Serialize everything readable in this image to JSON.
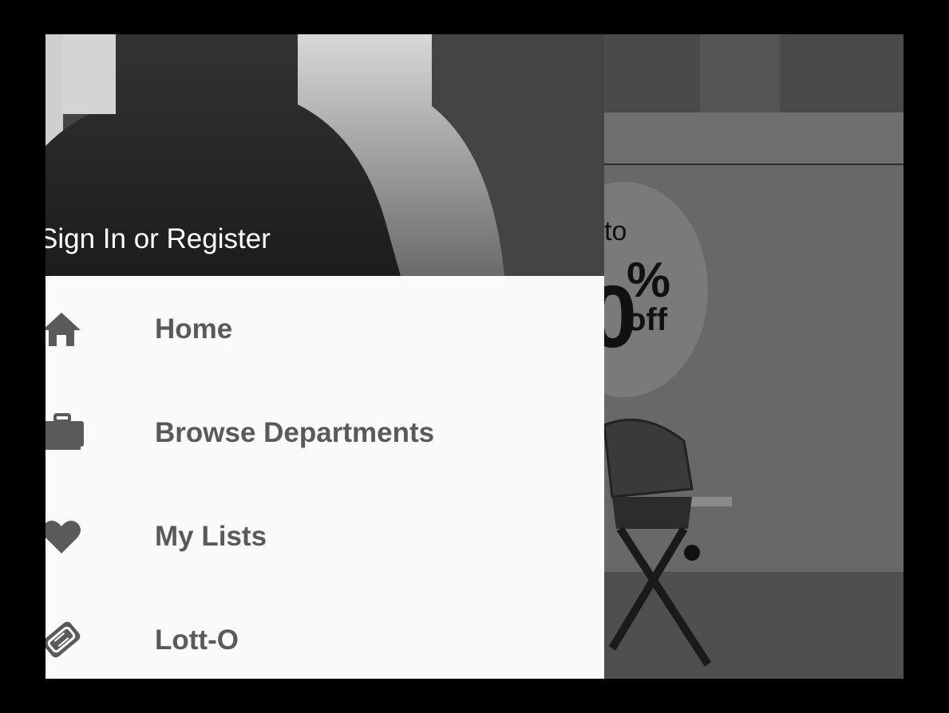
{
  "drawer": {
    "header": {
      "sign_in_label": "Sign In or Register"
    },
    "items": [
      {
        "label": "Home",
        "icon": "home-icon"
      },
      {
        "label": "Browse Departments",
        "icon": "briefcase-icon"
      },
      {
        "label": "My Lists",
        "icon": "heart-icon"
      },
      {
        "label": "Lott-O",
        "icon": "ticket-icon"
      }
    ]
  },
  "background": {
    "promo": {
      "prefix": "to",
      "number": "0",
      "percent": "%",
      "suffix": "off"
    }
  }
}
